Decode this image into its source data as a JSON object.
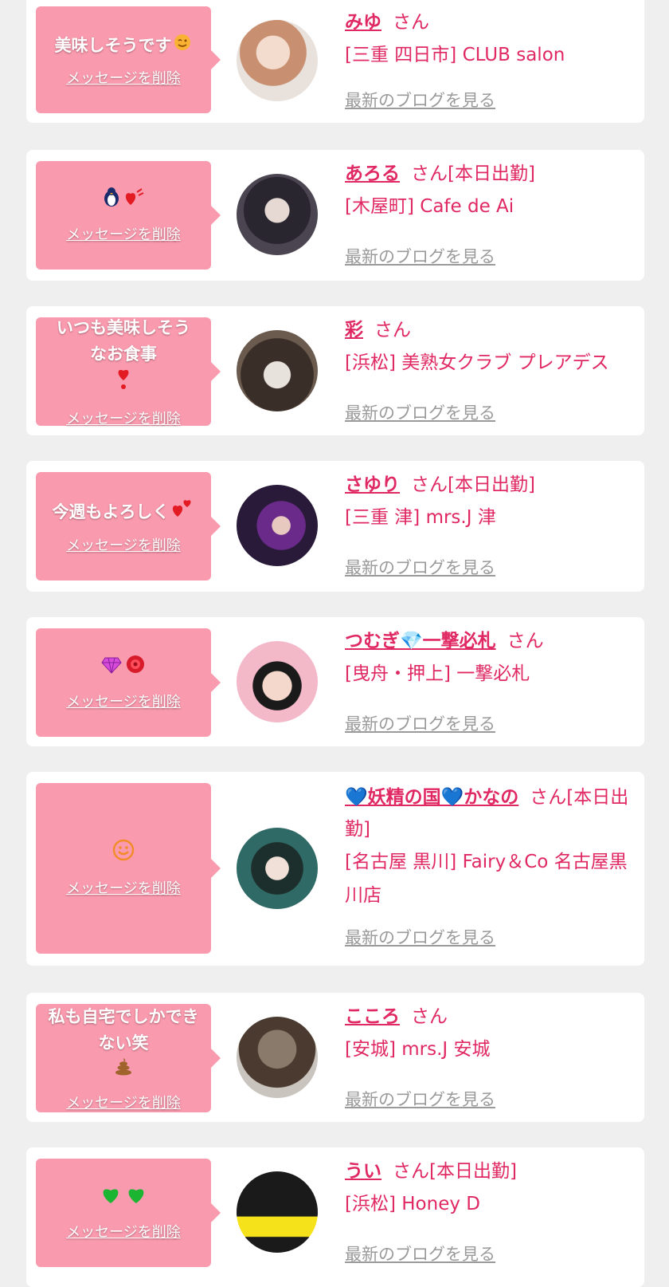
{
  "colors": {
    "accent": "#e02863",
    "bubble": "#fa9aae",
    "card": "#ffffff",
    "page": "#efefef",
    "link_gray": "#9a9a9a"
  },
  "labels": {
    "delete": "メッセージを削除",
    "blog": "最新のブログを見る",
    "san": "さん"
  },
  "messages": [
    {
      "message": "美味しそうです",
      "emoji": [
        "wink-face-icon"
      ],
      "name": "みゆ",
      "suffix": "さん",
      "shop": "[三重 四日市] CLUB salon"
    },
    {
      "message": "",
      "emoji": [
        "penguin-icon",
        "heart-icon"
      ],
      "name": "あろる",
      "suffix": "さん[本日出勤]",
      "shop": "[木屋町] Cafe de Ai"
    },
    {
      "message": "いつも美味しそうなお食事",
      "emoji": [
        "exclamation-heart-icon"
      ],
      "name": "彩",
      "suffix": "さん",
      "shop": "[浜松] 美熟女クラブ プレアデス"
    },
    {
      "message": "今週もよろしく",
      "emoji": [
        "two-hearts-icon"
      ],
      "name": "さゆり",
      "suffix": "さん[本日出勤]",
      "shop": "[三重 津] mrs.J 津"
    },
    {
      "message": "",
      "emoji": [
        "gem-icon",
        "rose-icon"
      ],
      "name": "つむぎ💎一撃必札",
      "suffix": "さん",
      "shop": "[曳舟・押上] 一撃必札"
    },
    {
      "message": "",
      "emoji": [
        "smile-face-icon"
      ],
      "name": "💙妖精の国💙かなの",
      "suffix": "さん[本日出勤]",
      "shop": "[名古屋 黒川] Fairy＆Co 名古屋黒川店"
    },
    {
      "message": "私も自宅でしかできない笑",
      "emoji": [
        "poop-icon"
      ],
      "name": "こころ",
      "suffix": "さん",
      "shop": "[安城] mrs.J 安城"
    },
    {
      "message": "",
      "emoji": [
        "green-heart-icon",
        "green-heart-icon"
      ],
      "name": "うい",
      "suffix": "さん[本日出勤]",
      "shop": "[浜松] Honey D"
    }
  ]
}
